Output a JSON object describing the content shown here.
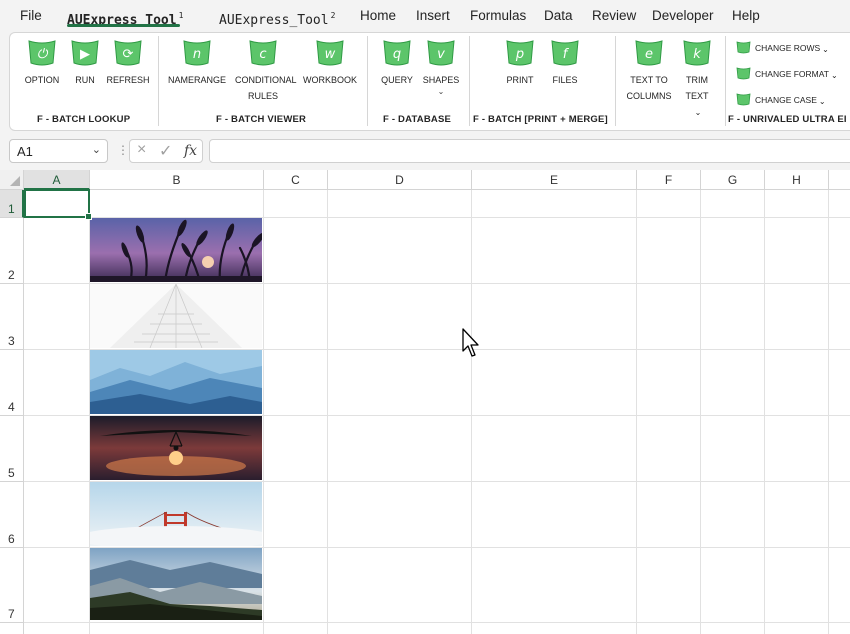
{
  "menu": {
    "items": [
      "File",
      "AUExpress_Tool",
      "AUExpress_Tool",
      "Home",
      "Insert",
      "Formulas",
      "Data",
      "Review",
      "Developer",
      "Help"
    ],
    "sups": [
      "",
      "1",
      "2",
      "",
      "",
      "",
      "",
      "",
      "",
      ""
    ],
    "active_index": 1
  },
  "ribbon": {
    "buttons": [
      "OPTION",
      "RUN",
      "REFRESH",
      "NAMERANGE",
      "CONDITIONAL RULES",
      "WORKBOOK",
      "QUERY",
      "SHAPES",
      "PRINT",
      "FILES",
      "TEXT TO COLUMNS",
      "TRIM TEXT"
    ],
    "button_glyphs": [
      "⏻",
      "▶",
      "⟳",
      "n",
      "c",
      "w",
      "q",
      "v",
      "p",
      "f",
      "e",
      "k"
    ],
    "small_buttons": [
      "CHANGE ROWS",
      "CHANGE FORMAT",
      "CHANGE CASE"
    ],
    "groups": [
      "F - BATCH LOOKUP",
      "F - BATCH VIEWER",
      "F - DATABASE",
      "F - BATCH [PRINT + MERGE]",
      "F - UNRIVALED ULTRA EI"
    ],
    "icon_color": "#5cc56a",
    "icon_color_dark": "#2f9a44"
  },
  "formula_bar": {
    "name_box": "A1",
    "cancel_icon": "×",
    "enter_icon": "✓",
    "fx_label": "fx",
    "value": ""
  },
  "grid": {
    "columns": [
      "A",
      "B",
      "C",
      "D",
      "E",
      "F",
      "G",
      "H"
    ],
    "rows": [
      "1",
      "2",
      "3",
      "4",
      "5",
      "6",
      "7"
    ],
    "selected_cell": "A1"
  },
  "images": [
    "wheat-silhouette-sunset",
    "white-skyscraper-looking-up",
    "blue-misty-mountains",
    "hang-glider-at-sunset",
    "bridge-tower-above-clouds",
    "forest-hills-in-fog"
  ],
  "colors": {
    "accent": "#217346",
    "chrome": "#f3f3f3"
  }
}
